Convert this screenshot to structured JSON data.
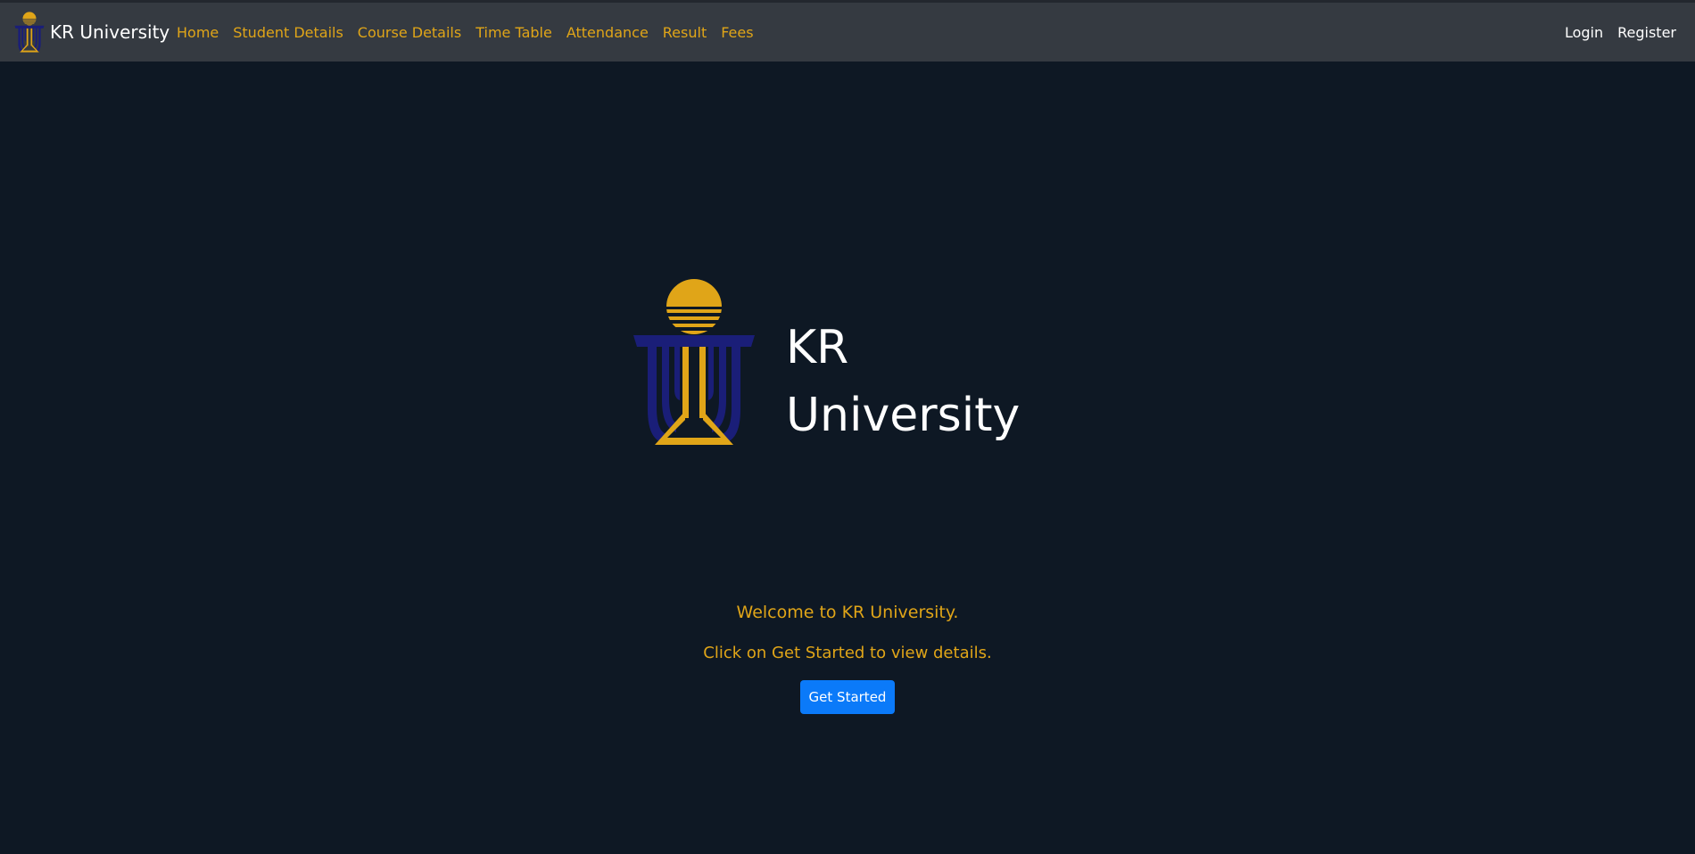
{
  "colors": {
    "background": "#0e1824",
    "navbar": "#353a41",
    "accent_gold": "#e0a518",
    "logo_navy": "#1a1e78",
    "button_blue": "#0b7af9",
    "text_white": "#ffffff"
  },
  "navbar": {
    "brand": {
      "logo_icon": "university-crest-logo",
      "name": "KR University"
    },
    "links": [
      {
        "label": "Home"
      },
      {
        "label": "Student Details"
      },
      {
        "label": "Course Details"
      },
      {
        "label": "Time Table"
      },
      {
        "label": "Attendance"
      },
      {
        "label": "Result"
      },
      {
        "label": "Fees"
      }
    ],
    "auth": {
      "login_label": "Login",
      "register_label": "Register"
    }
  },
  "hero": {
    "logo_icon": "university-crest-logo",
    "title_line1": "KR",
    "title_line2": "University"
  },
  "welcome": {
    "heading": "Welcome to KR University.",
    "subtext": "Click on Get Started to view details.",
    "button_label": "Get Started"
  }
}
